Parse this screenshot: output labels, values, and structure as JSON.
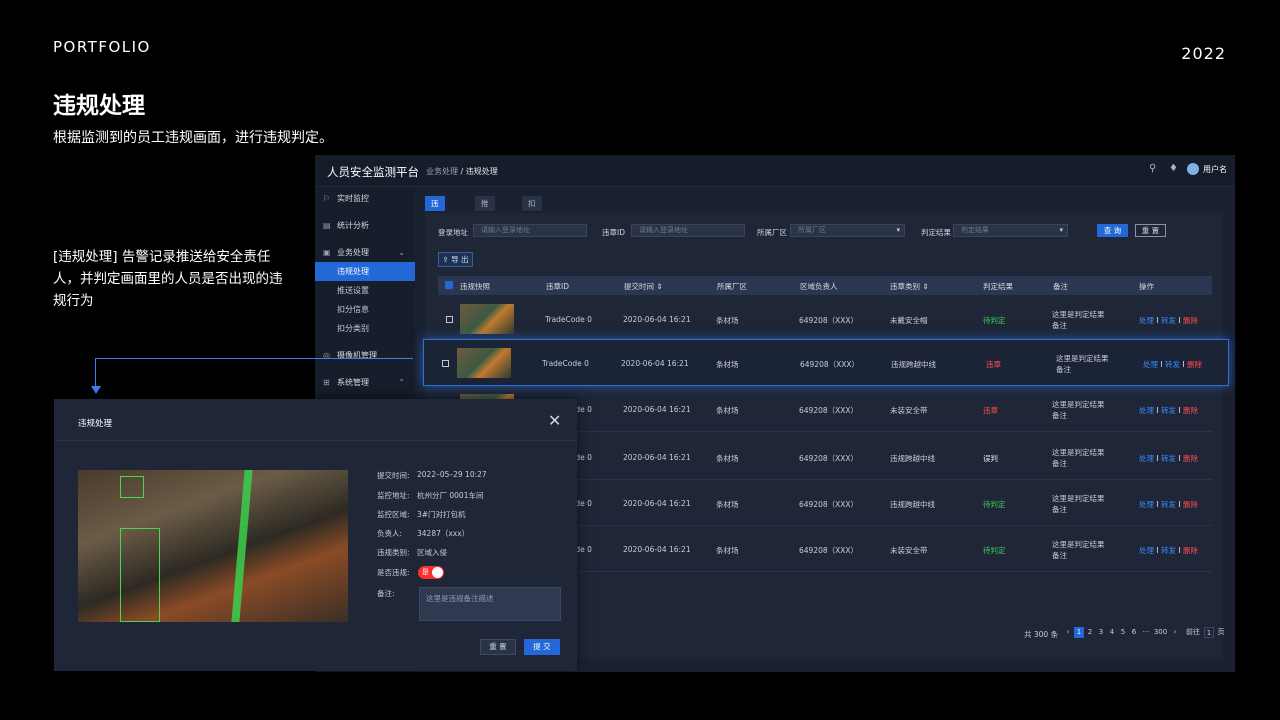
{
  "header": {
    "portfolio": "PORTFOLIO",
    "year": "2022",
    "title": "违规处理",
    "subtitle": "根据监测到的员工违规画面，进行违规判定。",
    "description": "[违规处理] 告警记录推送给安全责任人，并判定画面里的人员是否出现的违规行为"
  },
  "app": {
    "logo": "人员安全监测平台",
    "breadcrumb": {
      "parent": "业务处理",
      "sep": "/",
      "current": "违规处理"
    },
    "user": "用户名",
    "sidebar": [
      {
        "label": "实时监控",
        "icon": "flag-icon"
      },
      {
        "label": "统计分析",
        "icon": "chart-icon"
      },
      {
        "label": "业务处理",
        "icon": "briefcase-icon"
      },
      {
        "label": "违规处理"
      },
      {
        "label": "推送设置"
      },
      {
        "label": "扣分信息"
      },
      {
        "label": "扣分类别"
      },
      {
        "label": "摄像机管理",
        "icon": "camera-icon"
      },
      {
        "label": "系统管理",
        "icon": "grid-icon"
      }
    ],
    "tabs": [
      {
        "label": "违规处理"
      },
      {
        "label": "推送设置"
      },
      {
        "label": "扣分信息"
      }
    ],
    "filters": {
      "login_label": "登录地址",
      "login_placeholder": "请输入登录地址",
      "id_label": "违章ID",
      "id_placeholder": "请输入登录地址",
      "area_label": "所属厂区",
      "area_placeholder": "所属厂区",
      "result_label": "判定结果",
      "result_placeholder": "判定结果",
      "query": "查 询",
      "reset": "重 置",
      "export": "导 出"
    },
    "columns": [
      "违规快照",
      "违章ID",
      "提交时间",
      "所属厂区",
      "区域负责人",
      "违章类别",
      "判定结果",
      "备注",
      "操作"
    ],
    "rows": [
      {
        "id": "TradeCode 0",
        "time": "2020-06-04   16:21",
        "area": "条材场",
        "owner": "649208（XXX）",
        "type": "未戴安全帽",
        "result": "待判定",
        "result_class": "g",
        "note1": "这里是判定结果",
        "note2": "备注"
      },
      {
        "id": "TradeCode 0",
        "time": "2020-06-04   16:21",
        "area": "条材场",
        "owner": "649208（XXX）",
        "type": "违规跨越中线",
        "result": "违章",
        "result_class": "r",
        "note1": "这里是判定结果",
        "note2": "备注"
      },
      {
        "id": "TradeCode 0",
        "time": "2020-06-04   16:21",
        "area": "条材场",
        "owner": "649208（XXX）",
        "type": "未装安全带",
        "result": "违章",
        "result_class": "r",
        "note1": "这里是判定结果",
        "note2": "备注"
      },
      {
        "id": "TradeCode 0",
        "time": "2020-06-04   16:21",
        "area": "条材场",
        "owner": "649208（XXX）",
        "type": "违规跨越中线",
        "result": "误判",
        "result_class": "w",
        "note1": "这里是判定结果",
        "note2": "备注"
      },
      {
        "id": "TradeCode 0",
        "time": "2020-06-04   16:21",
        "area": "条材场",
        "owner": "649208（XXX）",
        "type": "违规跨越中线",
        "result": "待判定",
        "result_class": "g",
        "note1": "这里是判定结果",
        "note2": "备注"
      },
      {
        "id": "TradeCode 0",
        "time": "2020-06-04   16:21",
        "area": "条材场",
        "owner": "649208（XXX）",
        "type": "未装安全带",
        "result": "待判定",
        "result_class": "g",
        "note1": "这里是判定结果",
        "note2": "备注"
      }
    ],
    "ops": {
      "handle": "处理",
      "forward": "转发",
      "delete": "删除",
      "sep": "I"
    },
    "pager": {
      "total": "共 300 条",
      "pages": [
        "1",
        "2",
        "3",
        "4",
        "5",
        "6",
        "···",
        "300"
      ],
      "goto": "前往",
      "goto_value": "1",
      "page_suffix": "页"
    }
  },
  "modal": {
    "title": "违规处理",
    "fields": [
      {
        "label": "提交时间:",
        "value": "2022–05–29  10:27"
      },
      {
        "label": "监控地址:",
        "value": "杭州分厂  0001车间"
      },
      {
        "label": "监控区域:",
        "value": "3#门对打包机"
      },
      {
        "label": "负责人:",
        "value": "34287（xxx）"
      },
      {
        "label": "违规类别:",
        "value": "区域入侵"
      },
      {
        "label": "是否违规:",
        "value": ""
      },
      {
        "label": "备注:",
        "value": ""
      }
    ],
    "toggle": "是",
    "remark_placeholder": "这里是违规备注描述",
    "reset": "重 置",
    "submit": "提 交"
  }
}
